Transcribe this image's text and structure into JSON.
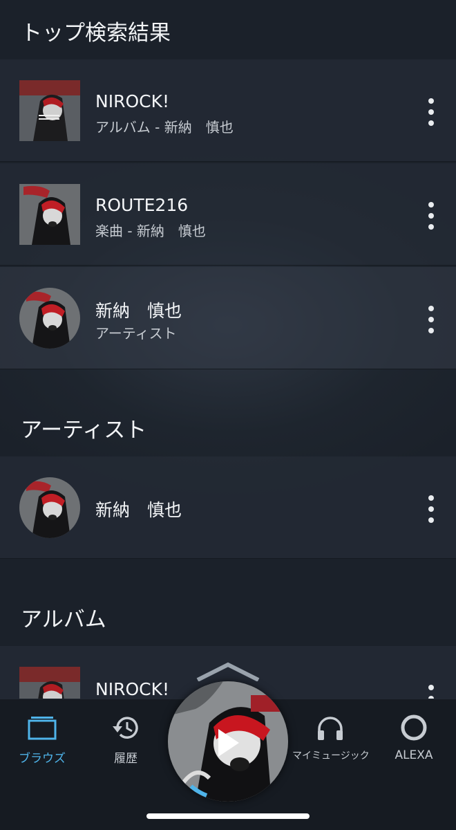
{
  "sections": {
    "top_results": {
      "title": "トップ検索結果"
    },
    "artists": {
      "title": "アーティスト"
    },
    "albums": {
      "title": "アルバム"
    }
  },
  "top_results": [
    {
      "title": "NIROCK!",
      "subtitle": "アルバム - 新納　慎也",
      "shape": "square"
    },
    {
      "title": "ROUTE216",
      "subtitle": "楽曲 - 新納　慎也",
      "shape": "square"
    },
    {
      "title": "新納　慎也",
      "subtitle": "アーティスト",
      "shape": "round"
    }
  ],
  "artists": [
    {
      "title": "新納　慎也"
    }
  ],
  "albums": [
    {
      "title": "NIROCK!"
    }
  ],
  "bottom_nav": {
    "browse": "ブラウズ",
    "history": "履歴",
    "my_music": "マイミュージック",
    "alexa": "ALEXA"
  },
  "player": {
    "state": "paused",
    "progress": 0.05
  },
  "colors": {
    "accent": "#4fb4ea",
    "background": "#1b212a"
  },
  "icons": [
    "more-vert-icon",
    "browse-icon",
    "history-icon",
    "headphones-icon",
    "alexa-icon",
    "play-icon",
    "chevron-up-icon"
  ]
}
